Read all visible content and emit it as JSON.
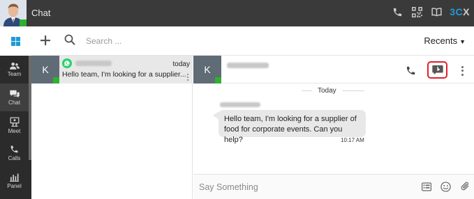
{
  "topbar": {
    "title": "Chat",
    "brand": {
      "prefix": "3C",
      "suffix": "X"
    },
    "icons": [
      "phone-icon",
      "qr-code-icon",
      "book-icon"
    ]
  },
  "leftnav": {
    "items": [
      {
        "label": "Team",
        "icon": "team-icon"
      },
      {
        "label": "Chat",
        "icon": "chat-icon",
        "active": true
      },
      {
        "label": "Meet",
        "icon": "meet-icon"
      },
      {
        "label": "Calls",
        "icon": "calls-icon"
      },
      {
        "label": "Panel",
        "icon": "panel-icon"
      }
    ]
  },
  "toolbar": {
    "search_placeholder": "Search ...",
    "recents_label": "Recents"
  },
  "conversations": [
    {
      "initial": "K",
      "time": "today",
      "preview": "Hello team, I'm looking for a supplier...",
      "channel_icon": "whatsapp-icon"
    }
  ],
  "chat": {
    "initial": "K",
    "day_label": "Today",
    "messages": [
      {
        "text": "Hello team, I'm looking for a supplier of food for corporate events. Can you help?",
        "time": "10:17 AM"
      }
    ],
    "composer_placeholder": "Say Something"
  },
  "colors": {
    "accent": "#1e9bd7",
    "online": "#2fb12f",
    "highlight_border": "#e0202a",
    "whatsapp": "#25d366"
  }
}
